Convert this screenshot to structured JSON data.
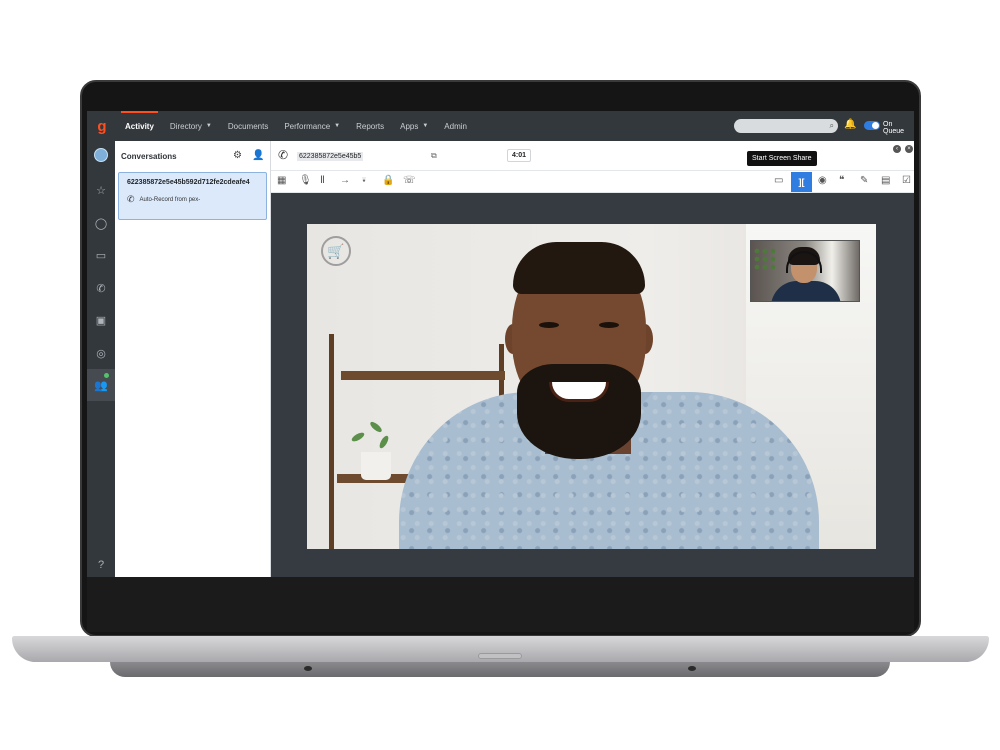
{
  "app": {
    "logo_glyph": "g",
    "nav": [
      "Activity",
      "Directory",
      "Documents",
      "Performance",
      "Reports",
      "Apps",
      "Admin"
    ],
    "status_label": "On Queue",
    "accent_color": "#ff4f1f",
    "primary_color": "#2f7de1"
  },
  "conversations": {
    "title": "Conversations",
    "items": [
      {
        "id": "622385872e5e45b592d712fe2cdeafe4",
        "subtitle": "Auto-Record from pex-"
      }
    ]
  },
  "call": {
    "number": "622385872e5e45b5",
    "timer": "4:01",
    "tooltip": "Start Screen Share"
  },
  "toolbar": {
    "icons": [
      "dialpad-icon",
      "mic-icon",
      "pause-icon",
      "transfer-icon",
      "add-participant-icon",
      "secure-icon",
      "callback-icon"
    ],
    "right_icons": [
      "screen-share-icon",
      "video-share-icon",
      "contact-icon",
      "script-icon",
      "notes-icon",
      "schedule-icon",
      "wrapup-icon"
    ]
  }
}
